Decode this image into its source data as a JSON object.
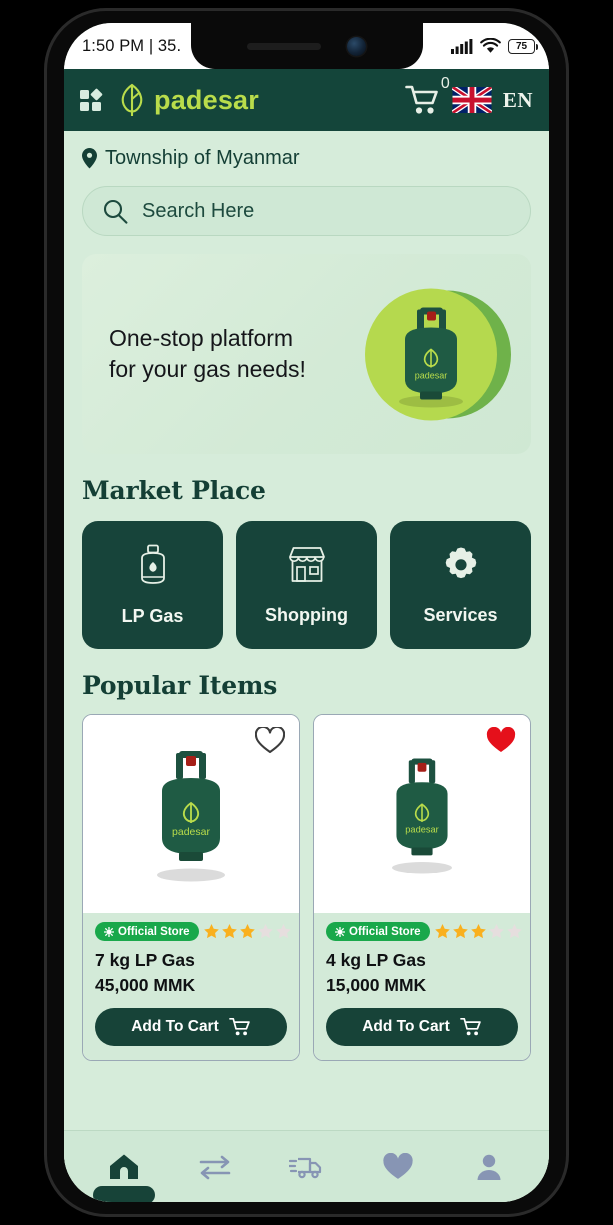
{
  "status_bar": {
    "clock": "1:50 PM | 35.",
    "battery": "75",
    "signal_icon": "cellular-signal-icon",
    "wifi_icon": "wifi-icon"
  },
  "header": {
    "menu_icon": "grid-menu-icon",
    "logo_icon": "padesar-leaf-logo-icon",
    "brand": "padesar",
    "cart_icon": "shopping-cart-icon",
    "cart_count": "0",
    "flag_icon": "uk-flag-icon",
    "language": "EN"
  },
  "location": {
    "pin_icon": "map-pin-icon",
    "text": "Township of Myanmar"
  },
  "search": {
    "icon": "search-icon",
    "placeholder": "Search Here",
    "value": ""
  },
  "banner": {
    "line1": "One-stop platform",
    "line2": "for your gas needs!",
    "art_icon": "gas-cylinder-illustration",
    "cylinder_label": "padesar"
  },
  "market_place": {
    "title": "Market Place",
    "cards": [
      {
        "label": "LP Gas",
        "icon": "gas-tank-icon"
      },
      {
        "label": "Shopping",
        "icon": "storefront-icon"
      },
      {
        "label": "Services",
        "icon": "gear-icon"
      }
    ]
  },
  "popular_items": {
    "title": "Popular Items",
    "items": [
      {
        "title": "7 kg LP Gas",
        "price": "45,000 MMK",
        "badge": "Official Store",
        "badge_icon": "verified-sun-icon",
        "rating": 3,
        "rating_max": 5,
        "favorite": false,
        "favorite_icon": "heart-outline-icon",
        "button_label": "Add To Cart",
        "button_icon": "cart-icon",
        "product_icon": "gas-cylinder-image",
        "product_brand": "padesar"
      },
      {
        "title": "4 kg LP Gas",
        "price": "15,000 MMK",
        "badge": "Official Store",
        "badge_icon": "verified-sun-icon",
        "rating": 3,
        "rating_max": 5,
        "favorite": true,
        "favorite_icon": "heart-filled-icon",
        "button_label": "Add To Cart",
        "button_icon": "cart-icon",
        "product_icon": "gas-cylinder-image",
        "product_brand": "padesar"
      }
    ]
  },
  "bottom_nav": {
    "items": [
      {
        "name": "home",
        "icon": "home-icon",
        "active": true
      },
      {
        "name": "transfer",
        "icon": "transfer-arrows-icon",
        "active": false
      },
      {
        "name": "delivery",
        "icon": "delivery-truck-icon",
        "active": false
      },
      {
        "name": "favorites",
        "icon": "heart-icon",
        "active": false
      },
      {
        "name": "profile",
        "icon": "person-icon",
        "active": false
      }
    ]
  },
  "colors": {
    "header_green": "#14453a",
    "page_bg": "#d6ecda",
    "brand_lime": "#b9dc4b",
    "badge_green": "#19a84b",
    "star_gold": "#f9b01e",
    "heart_red": "#e5101b",
    "nav_inactive": "#8795b4"
  }
}
